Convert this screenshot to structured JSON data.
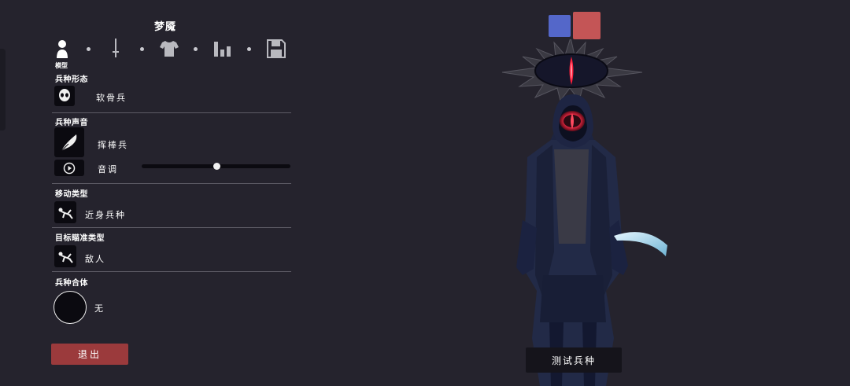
{
  "unit_name": "梦魇",
  "tabs": [
    {
      "icon": "person-icon"
    },
    {
      "icon": "sword-icon"
    },
    {
      "icon": "shirt-icon"
    },
    {
      "icon": "stats-icon"
    },
    {
      "icon": "save-icon"
    }
  ],
  "active_tab_label": "模型",
  "sections": {
    "form": {
      "label": "兵种形态",
      "value": "软骨兵",
      "icon": "skull-icon"
    },
    "voice": {
      "label": "兵种声音",
      "value": "挥棒兵",
      "icon": "feather-icon",
      "pitch_label": "音调",
      "pitch_level": 0.5,
      "play_icon": "play-icon"
    },
    "movement": {
      "label": "移动类型",
      "value": "近身兵种",
      "icon": "fallen-figure-icon"
    },
    "targeting": {
      "label": "目标瞄准类型",
      "value": "敌人",
      "icon": "fallen-figure-icon"
    },
    "combo": {
      "label": "兵种合体",
      "value": "无"
    }
  },
  "exit_button": "退出",
  "test_button": "测试兵种",
  "team_colors": {
    "blue": "#5467c9",
    "red": "#c45556"
  },
  "colors": {
    "background": "#25232d",
    "exit": "#9b3a3c",
    "eye_glow": "#ff2d4a"
  }
}
